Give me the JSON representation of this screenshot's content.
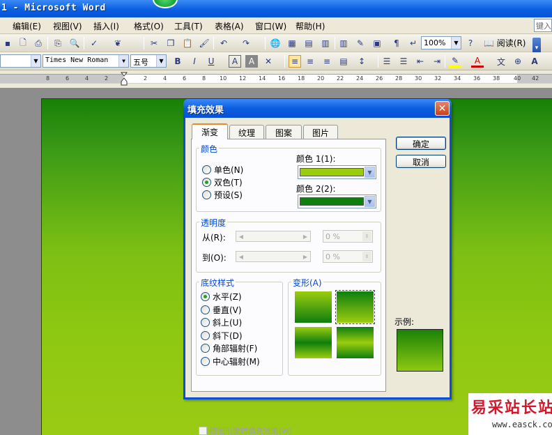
{
  "app": {
    "title": "1 - Microsoft Word"
  },
  "menu": {
    "items": [
      "编辑(E)",
      "视图(V)",
      "插入(I)",
      "格式(O)",
      "工具(T)",
      "表格(A)",
      "窗口(W)",
      "帮助(H)"
    ],
    "help_search": "键入"
  },
  "toolbar": {
    "zoom": "100%",
    "read_label": "阅读(R)",
    "font_name": "Times New Roman",
    "font_size": "五号"
  },
  "ruler": {
    "numbers": [
      "8",
      "6",
      "4",
      "2",
      "2",
      "4",
      "6",
      "8",
      "10",
      "12",
      "14",
      "16",
      "18",
      "20",
      "22",
      "24",
      "26",
      "28",
      "30",
      "32",
      "34",
      "36",
      "38",
      "40",
      "42"
    ]
  },
  "dialog": {
    "title": "填充效果",
    "tabs": [
      "渐变",
      "纹理",
      "图案",
      "图片"
    ],
    "color_group": {
      "title": "颜色",
      "options": [
        "单色(N)",
        "双色(T)",
        "预设(S)"
      ],
      "selected": "双色(T)",
      "color1_label": "颜色 1(1):",
      "color2_label": "颜色 2(2):",
      "color1": "#9acd0e",
      "color2": "#0e7e0e"
    },
    "transparency_group": {
      "title": "透明度",
      "from_label": "从(R):",
      "to_label": "到(O):",
      "from_value": "0 %",
      "to_value": "0 %"
    },
    "shading_group": {
      "title": "底纹样式",
      "options": [
        "水平(Z)",
        "垂直(V)",
        "斜上(U)",
        "斜下(D)",
        "角部辐射(F)",
        "中心辐射(M)"
      ],
      "selected": "水平(Z)"
    },
    "variants_group": {
      "title": "变形(A)"
    },
    "rotate_checkbox": "随图形旋转填充效果(W)",
    "ok": "确定",
    "cancel": "取消",
    "sample_label": "示例:"
  },
  "watermark": {
    "text": "易采站长站",
    "url": "www.easck.com"
  }
}
